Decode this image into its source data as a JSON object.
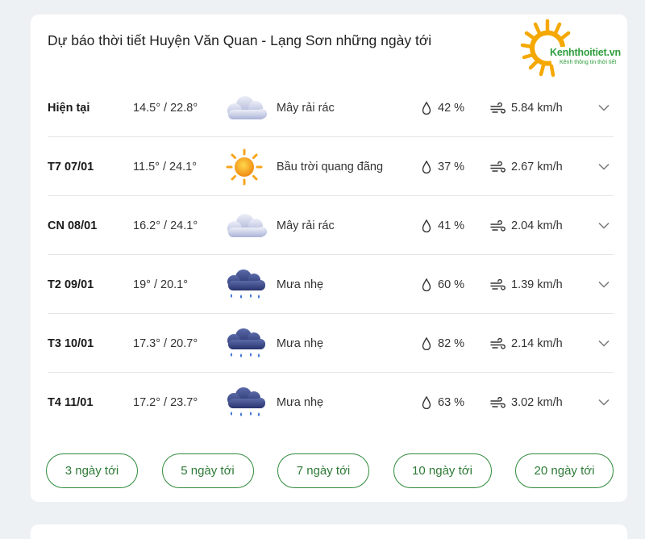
{
  "header": {
    "title": "Dự báo thời tiết Huyện Văn Quan - Lạng Sơn những ngày tới"
  },
  "logo": {
    "name": "Kenhthoitiet.vn",
    "tagline": "Kênh thông tin thời tiết",
    "brand_color": "#2e9e3e",
    "sun_color": "#f5a800"
  },
  "forecast": [
    {
      "day": "Hiện tại",
      "temp": "14.5° / 22.8°",
      "icon": "cloudy-icon",
      "desc": "Mây rải rác",
      "humidity": "42 %",
      "wind": "5.84 km/h"
    },
    {
      "day": "T7 07/01",
      "temp": "11.5° / 24.1°",
      "icon": "sunny-icon",
      "desc": "Bầu trời quang đãng",
      "humidity": "37 %",
      "wind": "2.67 km/h"
    },
    {
      "day": "CN 08/01",
      "temp": "16.2° / 24.1°",
      "icon": "cloudy-icon",
      "desc": "Mây rải rác",
      "humidity": "41 %",
      "wind": "2.04 km/h"
    },
    {
      "day": "T2 09/01",
      "temp": "19° / 20.1°",
      "icon": "rain-icon",
      "desc": "Mưa nhẹ",
      "humidity": "60 %",
      "wind": "1.39 km/h"
    },
    {
      "day": "T3 10/01",
      "temp": "17.3° / 20.7°",
      "icon": "rain-icon",
      "desc": "Mưa nhẹ",
      "humidity": "82 %",
      "wind": "2.14 km/h"
    },
    {
      "day": "T4 11/01",
      "temp": "17.2° / 23.7°",
      "icon": "rain-icon",
      "desc": "Mưa nhẹ",
      "humidity": "63 %",
      "wind": "3.02 km/h"
    }
  ],
  "buttons": [
    {
      "label": "3 ngày tới"
    },
    {
      "label": "5 ngày tới"
    },
    {
      "label": "7 ngày tới"
    },
    {
      "label": "10 ngày tới"
    },
    {
      "label": "20 ngày tới"
    }
  ],
  "colors": {
    "accent": "#2e8a3a",
    "background": "#eef1f4",
    "card": "#ffffff"
  }
}
